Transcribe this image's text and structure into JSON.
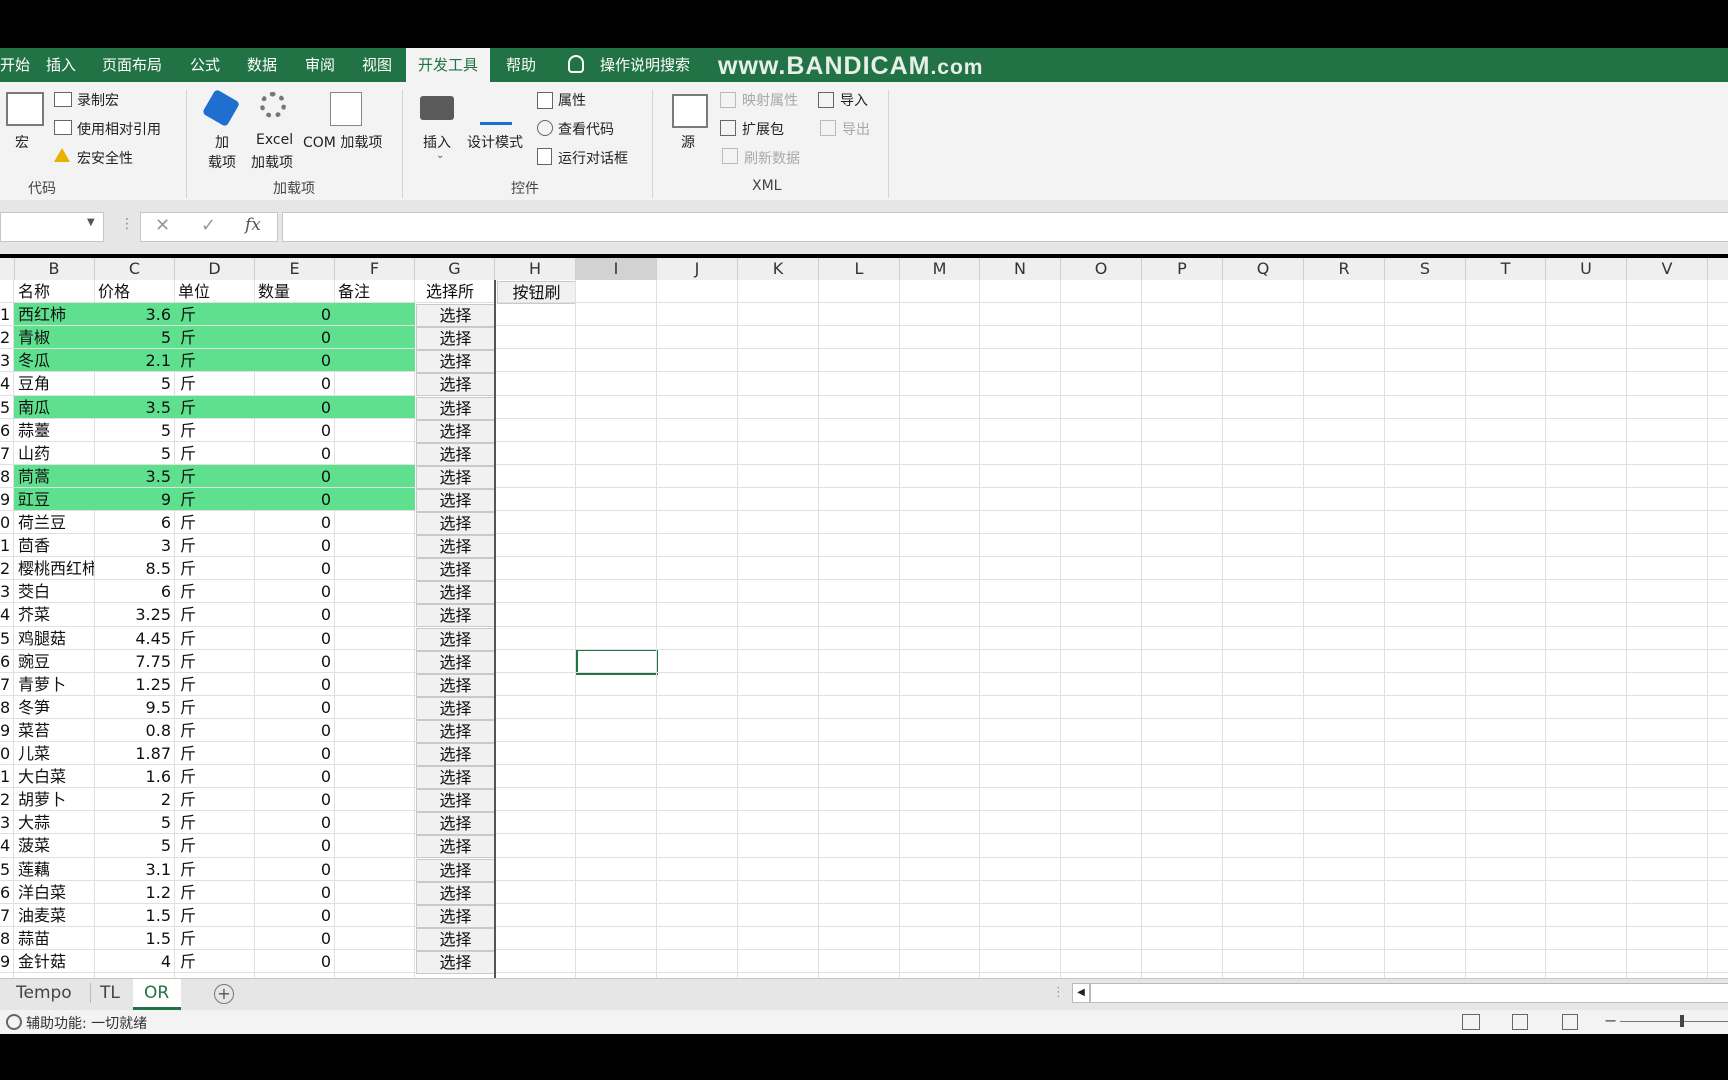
{
  "ribbon_tabs": [
    "开始",
    "插入",
    "页面布局",
    "公式",
    "数据",
    "审阅",
    "视图",
    "开发工具",
    "帮助",
    "操作说明搜索"
  ],
  "watermark": "www.BANDICAM.com",
  "ribbon": {
    "macro": "宏",
    "record_macro": "录制宏",
    "relative_ref": "使用相对引用",
    "macro_security": "宏安全性",
    "group_code": "代码",
    "addin_1": "加",
    "addin_2": "载项",
    "excel_addin_1": "Excel",
    "excel_addin_2": "加载项",
    "com_addin": "COM 加载项",
    "group_addins": "加载项",
    "insert": "插入",
    "design_mode": "设计模式",
    "properties": "属性",
    "view_code": "查看代码",
    "run_dialog": "运行对话框",
    "group_controls": "控件",
    "source": "源",
    "map_props": "映射属性",
    "expansion_pack": "扩展包",
    "refresh_data": "刷新数据",
    "import": "导入",
    "export": "导出",
    "group_xml": "XML"
  },
  "formula_bar": {
    "fx": "fx",
    "cancel": "✕",
    "enter": "✓"
  },
  "columns": [
    "B",
    "C",
    "D",
    "E",
    "F",
    "G",
    "H",
    "I",
    "J",
    "K",
    "L",
    "M",
    "N",
    "O",
    "P",
    "Q",
    "R",
    "S",
    "T",
    "U",
    "V"
  ],
  "header_row": {
    "b": "名称",
    "c": "价格",
    "d": "单位",
    "e": "数量",
    "f": "备注",
    "g": "选择所",
    "h": "按钮刷"
  },
  "rows": [
    {
      "n": "1",
      "name": "西红柿",
      "price": "3.6",
      "unit": "斤",
      "qty": "0",
      "hl": true
    },
    {
      "n": "2",
      "name": "青椒",
      "price": "5",
      "unit": "斤",
      "qty": "0",
      "hl": true
    },
    {
      "n": "3",
      "name": "冬瓜",
      "price": "2.1",
      "unit": "斤",
      "qty": "0",
      "hl": true
    },
    {
      "n": "4",
      "name": "豆角",
      "price": "5",
      "unit": "斤",
      "qty": "0",
      "hl": false
    },
    {
      "n": "5",
      "name": "南瓜",
      "price": "3.5",
      "unit": "斤",
      "qty": "0",
      "hl": true
    },
    {
      "n": "6",
      "name": "蒜薹",
      "price": "5",
      "unit": "斤",
      "qty": "0",
      "hl": false
    },
    {
      "n": "7",
      "name": "山药",
      "price": "5",
      "unit": "斤",
      "qty": "0",
      "hl": false
    },
    {
      "n": "8",
      "name": "茼蒿",
      "price": "3.5",
      "unit": "斤",
      "qty": "0",
      "hl": true
    },
    {
      "n": "9",
      "name": "豇豆",
      "price": "9",
      "unit": "斤",
      "qty": "0",
      "hl": true
    },
    {
      "n": "0",
      "name": "荷兰豆",
      "price": "6",
      "unit": "斤",
      "qty": "0",
      "hl": false
    },
    {
      "n": "1",
      "name": "茴香",
      "price": "3",
      "unit": "斤",
      "qty": "0",
      "hl": false
    },
    {
      "n": "2",
      "name": "樱桃西红柿",
      "price": "8.5",
      "unit": "斤",
      "qty": "0",
      "hl": false
    },
    {
      "n": "3",
      "name": "茭白",
      "price": "6",
      "unit": "斤",
      "qty": "0",
      "hl": false
    },
    {
      "n": "4",
      "name": "芥菜",
      "price": "3.25",
      "unit": "斤",
      "qty": "0",
      "hl": false
    },
    {
      "n": "5",
      "name": "鸡腿菇",
      "price": "4.45",
      "unit": "斤",
      "qty": "0",
      "hl": false
    },
    {
      "n": "6",
      "name": "豌豆",
      "price": "7.75",
      "unit": "斤",
      "qty": "0",
      "hl": false
    },
    {
      "n": "7",
      "name": "青萝卜",
      "price": "1.25",
      "unit": "斤",
      "qty": "0",
      "hl": false
    },
    {
      "n": "8",
      "name": "冬笋",
      "price": "9.5",
      "unit": "斤",
      "qty": "0",
      "hl": false
    },
    {
      "n": "9",
      "name": "菜苔",
      "price": "0.8",
      "unit": "斤",
      "qty": "0",
      "hl": false
    },
    {
      "n": "0",
      "name": "儿菜",
      "price": "1.87",
      "unit": "斤",
      "qty": "0",
      "hl": false
    },
    {
      "n": "1",
      "name": "大白菜",
      "price": "1.6",
      "unit": "斤",
      "qty": "0",
      "hl": false
    },
    {
      "n": "2",
      "name": "胡萝卜",
      "price": "2",
      "unit": "斤",
      "qty": "0",
      "hl": false
    },
    {
      "n": "3",
      "name": "大蒜",
      "price": "5",
      "unit": "斤",
      "qty": "0",
      "hl": false
    },
    {
      "n": "4",
      "name": "菠菜",
      "price": "5",
      "unit": "斤",
      "qty": "0",
      "hl": false
    },
    {
      "n": "5",
      "name": "莲藕",
      "price": "3.1",
      "unit": "斤",
      "qty": "0",
      "hl": false
    },
    {
      "n": "6",
      "name": "洋白菜",
      "price": "1.2",
      "unit": "斤",
      "qty": "0",
      "hl": false
    },
    {
      "n": "7",
      "name": "油麦菜",
      "price": "1.5",
      "unit": "斤",
      "qty": "0",
      "hl": false
    },
    {
      "n": "8",
      "name": "蒜苗",
      "price": "1.5",
      "unit": "斤",
      "qty": "0",
      "hl": false
    },
    {
      "n": "9",
      "name": "金针菇",
      "price": "4",
      "unit": "斤",
      "qty": "0",
      "hl": false
    }
  ],
  "select_label": "选择",
  "sheet_tabs": [
    "Tempo",
    "TL",
    "OR"
  ],
  "status_text": "辅助功能: 一切就绪",
  "colors": {
    "accent": "#217346",
    "highlight": "#5ee08f"
  }
}
